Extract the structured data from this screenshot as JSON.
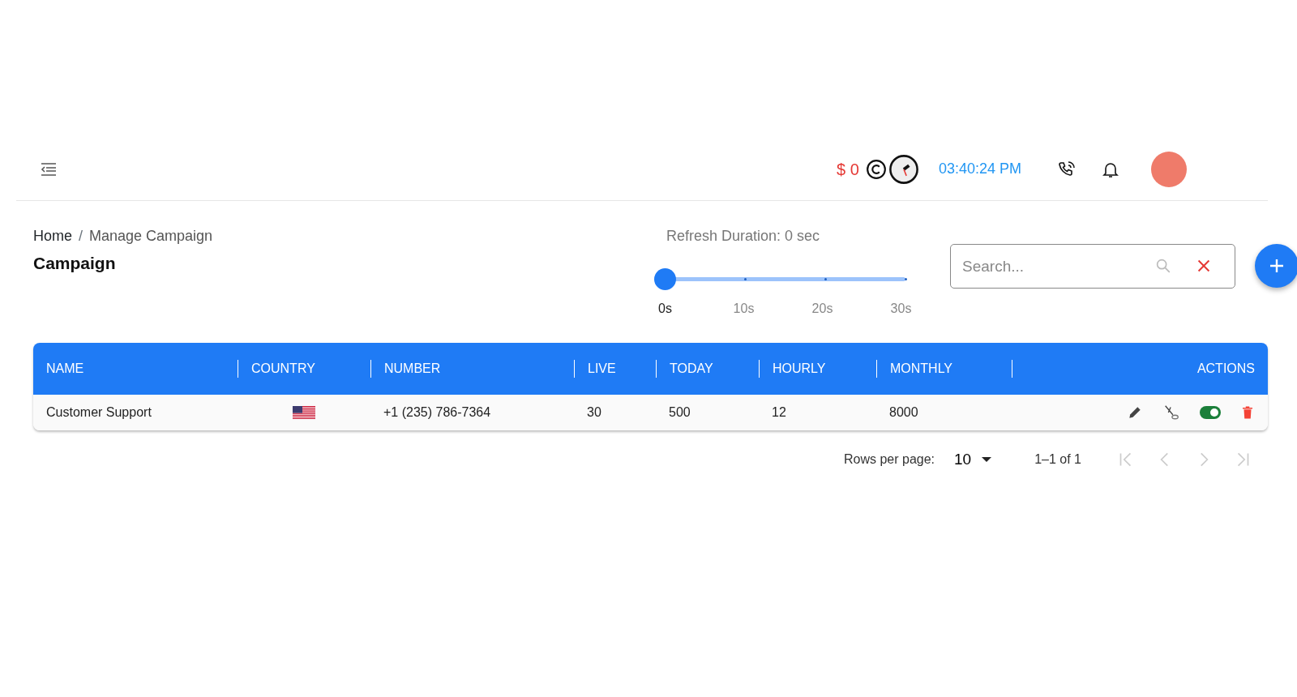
{
  "header": {
    "balance": "$ 0",
    "clock": "03:40:24 PM"
  },
  "breadcrumb": {
    "items": [
      "Home",
      "Manage Campaign"
    ],
    "separator": "/",
    "title": "Campaign"
  },
  "refresh": {
    "label": "Refresh Duration: 0 sec",
    "level": 0,
    "ticks": [
      {
        "label": "0s",
        "selected": true
      },
      {
        "label": "10s",
        "selected": false
      },
      {
        "label": "20s",
        "selected": false
      },
      {
        "label": "30s",
        "selected": false
      }
    ]
  },
  "search": {
    "placeholder": "Search..."
  },
  "table": {
    "columns": [
      "NAME",
      "COUNTRY",
      "NUMBER",
      "LIVE",
      "TODAY",
      "HOURLY",
      "MONTHLY",
      "ACTIONS"
    ],
    "rows": [
      {
        "name": "Customer Support",
        "number": "+1 (235) 786-7364",
        "live": "30",
        "today": "500",
        "hourly": "12",
        "monthly": "8000",
        "on": true
      }
    ]
  },
  "pagination": {
    "rows_label": "Rows per page:",
    "rows_per_page": "10",
    "range": "1–1 of 1",
    "first_disabled": true,
    "prev_disabled": true,
    "next_disabled": true,
    "last_disabled": true
  }
}
